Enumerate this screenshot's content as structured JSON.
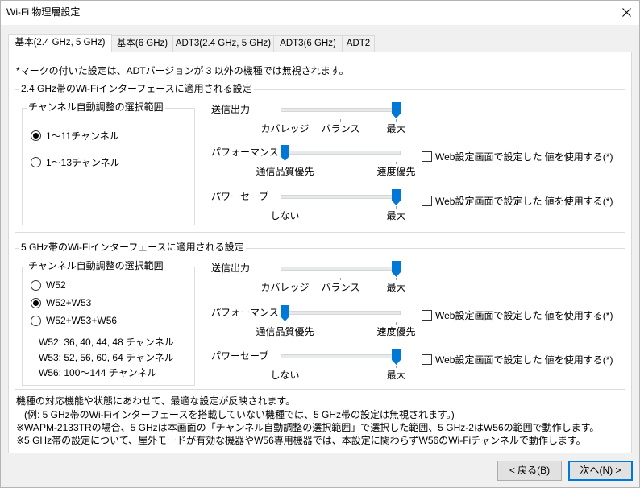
{
  "window": {
    "title": "Wi-Fi 物理層設定"
  },
  "tabs": [
    {
      "label": "基本(2.4 GHz, 5 GHz)",
      "selected": true
    },
    {
      "label": "基本(6 GHz)",
      "selected": false
    },
    {
      "label": "ADT3(2.4 GHz, 5 GHz)",
      "selected": false
    },
    {
      "label": "ADT3(6 GHz)",
      "selected": false
    },
    {
      "label": "ADT2",
      "selected": false
    }
  ],
  "note": "*マークの付いた設定は、ADTバージョンが 3 以外の機種では無視されます。",
  "band_24ghz": {
    "title": "2.4 GHz帯のWi-Fiインターフェースに適用される設定",
    "channel_range": {
      "title": "チャンネル自動調整の選択範囲",
      "options": [
        {
          "label": "1～11チャンネル",
          "checked": true
        },
        {
          "label": "1～13チャンネル",
          "checked": false
        }
      ]
    },
    "tx_power": {
      "label": "送信出力",
      "scale": [
        "カバレッジ",
        "バランス",
        "最大"
      ],
      "level": 1
    },
    "performance": {
      "label": "パフォーマンス",
      "scale": [
        "通信品質優先",
        "速度優先"
      ],
      "level": 0,
      "use_web_setting": {
        "label": "Web設定画面で設定した 値を使用する(*)",
        "checked": false
      }
    },
    "power_save": {
      "label": "パワーセーブ",
      "scale": [
        "しない",
        "最大"
      ],
      "level": 1,
      "use_web_setting": {
        "label": "Web設定画面で設定した 値を使用する(*)",
        "checked": false
      }
    }
  },
  "band_5ghz": {
    "title": "5 GHz帯のWi-Fiインターフェースに適用される設定",
    "channel_range": {
      "title": "チャンネル自動調整の選択範囲",
      "options": [
        {
          "label": "W52",
          "checked": false
        },
        {
          "label": "W52+W53",
          "checked": true
        },
        {
          "label": "W52+W53+W56",
          "checked": false
        }
      ],
      "channel_lists": [
        "W52: 36, 40, 44, 48 チャンネル",
        "W53: 52, 56, 60, 64 チャンネル",
        "W56: 100～144 チャンネル"
      ]
    },
    "tx_power": {
      "label": "送信出力",
      "scale": [
        "カバレッジ",
        "バランス",
        "最大"
      ],
      "level": 1
    },
    "performance": {
      "label": "パフォーマンス",
      "scale": [
        "通信品質優先",
        "速度優先"
      ],
      "level": 0,
      "use_web_setting": {
        "label": "Web設定画面で設定した 値を使用する(*)",
        "checked": false
      }
    },
    "power_save": {
      "label": "パワーセーブ",
      "scale": [
        "しない",
        "最大"
      ],
      "level": 1,
      "use_web_setting": {
        "label": "Web設定画面で設定した 値を使用する(*)",
        "checked": false
      }
    }
  },
  "footer_notes": [
    "機種の対応機能や状態にあわせて、最適な設定が反映されます。",
    "(例: 5 GHz帯のWi-Fiインターフェースを搭載していない機種では、5 GHz帯の設定は無視されます。)",
    "※WAPM-2133TRの場合、5 GHzは本画面の「チャンネル自動調整の選択範囲」で選択した範囲、5 GHz-2はW56の範囲で動作します。",
    "※5 GHz帯の設定について、屋外モードが有効な機器やW56専用機器では、本設定に関わらずW56のWi-Fiチャンネルで動作します。"
  ],
  "buttons": {
    "back": "< 戻る(B)",
    "next": "次へ(N) >"
  },
  "icons": {
    "close": "close-icon",
    "slider_thumb": "slider-thumb-icon"
  },
  "colors": {
    "accent": "#0078d7"
  }
}
